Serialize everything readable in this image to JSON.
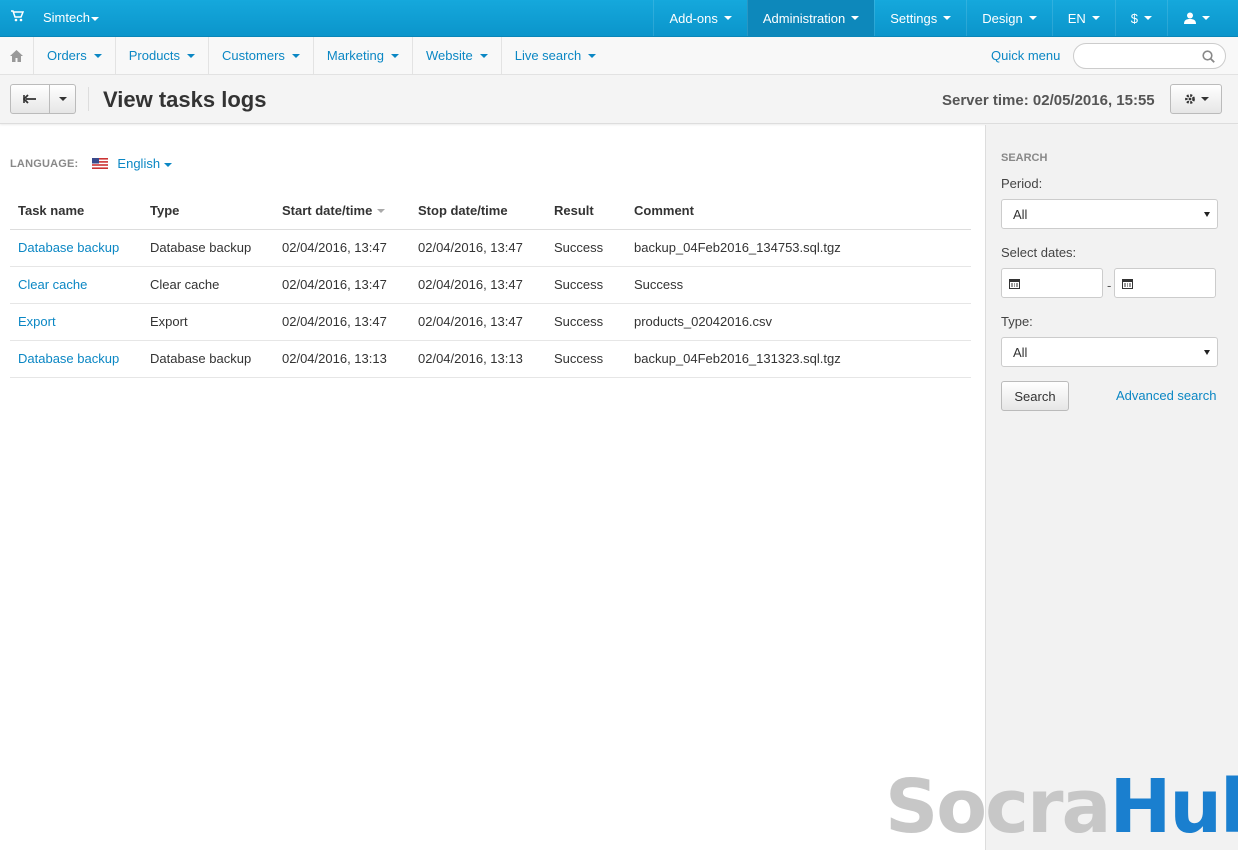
{
  "topbar": {
    "store_name": "Simtech",
    "nav": [
      {
        "label": "Add-ons"
      },
      {
        "label": "Administration"
      },
      {
        "label": "Settings"
      },
      {
        "label": "Design"
      },
      {
        "label": "EN"
      },
      {
        "label": "$"
      }
    ],
    "icons": {
      "cart": "cart-icon",
      "user": "user-icon"
    }
  },
  "subnav": {
    "menus": [
      {
        "label": "Orders"
      },
      {
        "label": "Products"
      },
      {
        "label": "Customers"
      },
      {
        "label": "Marketing"
      },
      {
        "label": "Website"
      },
      {
        "label": "Live search"
      }
    ],
    "quick_menu": "Quick menu",
    "search_value": ""
  },
  "titlebar": {
    "title": "View tasks logs",
    "server_time": "Server time: 02/05/2016, 15:55"
  },
  "language": {
    "label": "LANGUAGE:",
    "value": "English"
  },
  "table": {
    "headers": [
      "Task name",
      "Type",
      "Start date/time",
      "Stop date/time",
      "Result",
      "Comment"
    ],
    "rows": [
      {
        "task": "Database backup",
        "type": "Database backup",
        "start": "02/04/2016, 13:47",
        "stop": "02/04/2016, 13:47",
        "result": "Success",
        "comment": "backup_04Feb2016_134753.sql.tgz"
      },
      {
        "task": "Clear cache",
        "type": "Clear cache",
        "start": "02/04/2016, 13:47",
        "stop": "02/04/2016, 13:47",
        "result": "Success",
        "comment": "Success"
      },
      {
        "task": "Export",
        "type": "Export",
        "start": "02/04/2016, 13:47",
        "stop": "02/04/2016, 13:47",
        "result": "Success",
        "comment": "products_02042016.csv"
      },
      {
        "task": "Database backup",
        "type": "Database backup",
        "start": "02/04/2016, 13:13",
        "stop": "02/04/2016, 13:13",
        "result": "Success",
        "comment": "backup_04Feb2016_131323.sql.tgz"
      }
    ]
  },
  "sidebar": {
    "heading": "SEARCH",
    "period_label": "Period:",
    "period_value": "All",
    "dates_label": "Select dates:",
    "date_from": "",
    "date_to": "",
    "dash": "-",
    "type_label": "Type:",
    "type_value": "All",
    "search_button": "Search",
    "advanced_search": "Advanced search"
  },
  "watermark": {
    "part1": "Socra",
    "part2": "Hub"
  },
  "colors": {
    "accent": "#0b87c4",
    "topbar": "#12a2d7"
  }
}
